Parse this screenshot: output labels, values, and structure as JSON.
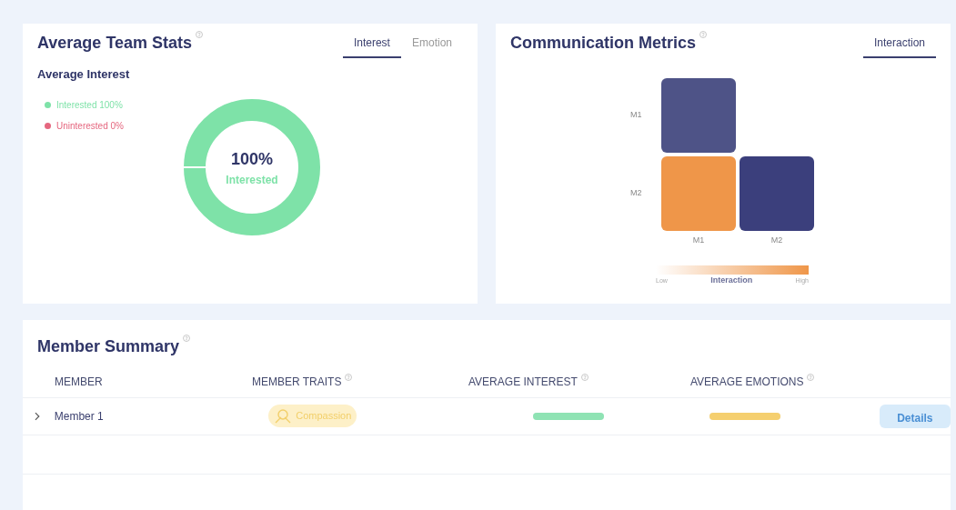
{
  "team_stats": {
    "title": "Average Team Stats",
    "tabs": [
      {
        "label": "Interest",
        "selected": true
      },
      {
        "label": "Emotion",
        "selected": false
      }
    ],
    "subtitle": "Average Interest",
    "legend": [
      {
        "label": "Interested 100%",
        "color": "#7ee2a8"
      },
      {
        "label": "Uninterested 0%",
        "color": "#e5677f"
      }
    ],
    "donut": {
      "level": 1,
      "value": "100%",
      "label": "Interested"
    }
  },
  "communication": {
    "title": "Communication Metrics",
    "tabs": [
      {
        "label": "Interaction",
        "selected": true
      }
    ],
    "rows": [
      "M1",
      "M2"
    ],
    "columns": [
      "M1",
      "M2"
    ],
    "cells": [
      [
        {
          "color": "#4e5387"
        },
        null
      ],
      [
        {
          "color": "#ef9649"
        },
        {
          "color": "#3b3f7c"
        }
      ]
    ],
    "scale": {
      "low": "Low",
      "label": "Interaction",
      "high": "High"
    }
  },
  "members": {
    "title": "Member Summary",
    "columns": [
      {
        "label": "MEMBER",
        "help": false
      },
      {
        "label": "MEMBER TRAITS",
        "help": true
      },
      {
        "label": "AVERAGE INTEREST",
        "help": true
      },
      {
        "label": "AVERAGE EMOTIONS",
        "help": true
      }
    ],
    "rows": [
      {
        "name": "Member 1",
        "expanded": false,
        "trait": "Compassion",
        "interest": {
          "level": 1,
          "color": "#8fe3b4"
        },
        "emotion": {
          "level": 1,
          "color": "#f5cf6f"
        },
        "action": {
          "label": "Details",
          "disabled": true
        }
      }
    ]
  }
}
